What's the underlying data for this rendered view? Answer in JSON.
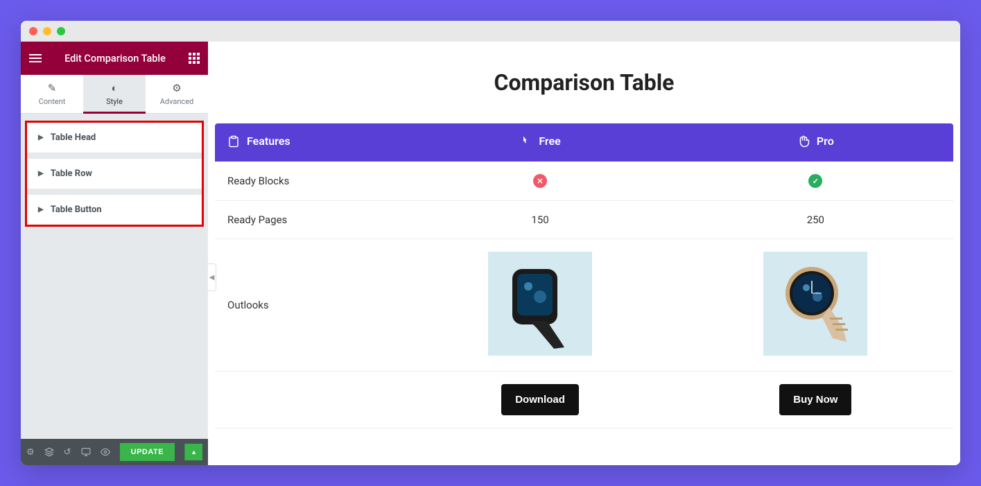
{
  "sidebar": {
    "title": "Edit Comparison Table",
    "tabs": {
      "content": "Content",
      "style": "Style",
      "advanced": "Advanced"
    },
    "accordion": {
      "head": "Table Head",
      "row": "Table Row",
      "button": "Table Button"
    },
    "footer": {
      "update": "UPDATE"
    }
  },
  "canvas": {
    "title": "Comparison Table",
    "headers": {
      "features": "Features",
      "col1": "Free",
      "col2": "Pro"
    },
    "rows": {
      "r1": {
        "label": "Ready Blocks"
      },
      "r2": {
        "label": "Ready Pages",
        "v1": "150",
        "v2": "250"
      },
      "r3": {
        "label": "Outlooks"
      }
    },
    "actions": {
      "a1": "Download",
      "a2": "Buy Now"
    }
  }
}
